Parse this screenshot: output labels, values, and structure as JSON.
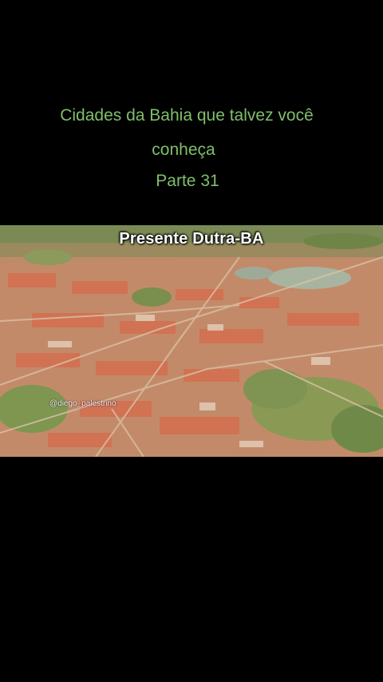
{
  "caption": {
    "line1": "Cidades da Bahia que talvez você",
    "line2": "conheça",
    "line3": "Parte 31"
  },
  "photo": {
    "title": "Presente Dutra-BA",
    "watermark": "@diego_palestrino"
  },
  "colors": {
    "background": "#000000",
    "caption_text": "#7fbf6a",
    "photo_title": "#ffffff"
  }
}
